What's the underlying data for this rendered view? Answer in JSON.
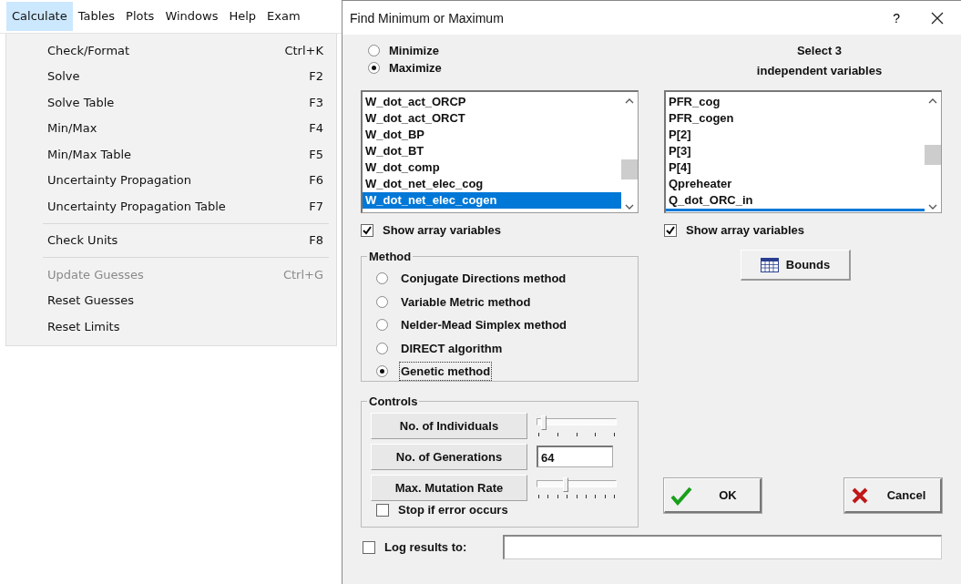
{
  "menu_bar": [
    {
      "label": "Calculate",
      "selected": true
    },
    {
      "label": "Tables",
      "selected": false
    },
    {
      "label": "Plots",
      "selected": false
    },
    {
      "label": "Windows",
      "selected": false
    },
    {
      "label": "Help",
      "selected": false
    },
    {
      "label": "Exam",
      "selected": false
    }
  ],
  "menu": {
    "groups": [
      [
        {
          "label": "Check/Format",
          "shortcut": "Ctrl+K",
          "disabled": false
        },
        {
          "label": "Solve",
          "shortcut": "F2",
          "disabled": false
        },
        {
          "label": "Solve Table",
          "shortcut": "F3",
          "disabled": false
        },
        {
          "label": "Min/Max",
          "shortcut": "F4",
          "disabled": false
        },
        {
          "label": "Min/Max Table",
          "shortcut": "F5",
          "disabled": false
        },
        {
          "label": "Uncertainty Propagation",
          "shortcut": "F6",
          "disabled": false
        },
        {
          "label": "Uncertainty Propagation Table",
          "shortcut": "F7",
          "disabled": false
        }
      ],
      [
        {
          "label": "Check Units",
          "shortcut": "F8",
          "disabled": false
        }
      ],
      [
        {
          "label": "Update Guesses",
          "shortcut": "Ctrl+G",
          "disabled": true
        },
        {
          "label": "Reset Guesses",
          "disabled": false
        },
        {
          "label": "Reset Limits",
          "disabled": false
        }
      ]
    ]
  },
  "dialog": {
    "title": "Find Minimum or Maximum",
    "help": "?"
  },
  "objective": [
    {
      "label": "Minimize",
      "selected": false
    },
    {
      "label": "Maximize",
      "selected": true
    }
  ],
  "dependent": {
    "items": [
      {
        "label": "W_dot_act_ORCP",
        "selected": false
      },
      {
        "label": "W_dot_act_ORCT",
        "selected": false
      },
      {
        "label": "W_dot_BP",
        "selected": false
      },
      {
        "label": "W_dot_BT",
        "selected": false
      },
      {
        "label": "W_dot_comp",
        "selected": false
      },
      {
        "label": "W_dot_net_elec_cog",
        "selected": false
      },
      {
        "label": "W_dot_net_elec_cogen",
        "selected": true
      }
    ],
    "show_array": {
      "label": "Show array variables",
      "checked": true
    }
  },
  "independent": {
    "heading": [
      "Select 3",
      "independent variables"
    ],
    "items": [
      {
        "label": "PFR_cog",
        "selected": false
      },
      {
        "label": "PFR_cogen",
        "selected": false
      },
      {
        "label": "P[2]",
        "selected": false
      },
      {
        "label": "P[3]",
        "selected": false
      },
      {
        "label": "P[4]",
        "selected": false
      },
      {
        "label": "Qpreheater",
        "selected": false
      },
      {
        "label": "Q_dot_ORC_in",
        "selected": false
      }
    ],
    "next_row_selected": true,
    "show_array": {
      "label": "Show array variables",
      "checked": true
    }
  },
  "method": {
    "title": "Method",
    "options": [
      {
        "label": "Conjugate Directions method",
        "selected": false
      },
      {
        "label": "Variable Metric method",
        "selected": false
      },
      {
        "label": "Nelder-Mead Simplex method",
        "selected": false
      },
      {
        "label": "DIRECT algorithm",
        "selected": false
      },
      {
        "label": "Genetic method",
        "selected": true
      }
    ]
  },
  "bounds_button": "Bounds",
  "controls": {
    "title": "Controls",
    "rows": [
      {
        "kind": "slider",
        "label": "No. of Individuals",
        "level": 0.05
      },
      {
        "kind": "field",
        "label": "No. of Generations",
        "value": "64"
      },
      {
        "kind": "slider",
        "label": "Max. Mutation Rate",
        "level": 0.35
      }
    ],
    "stop_on_error": {
      "label": "Stop if error occurs",
      "checked": false
    }
  },
  "ok_button": "OK",
  "cancel_button": "Cancel",
  "log": {
    "label": "Log results to:",
    "checked": false
  }
}
